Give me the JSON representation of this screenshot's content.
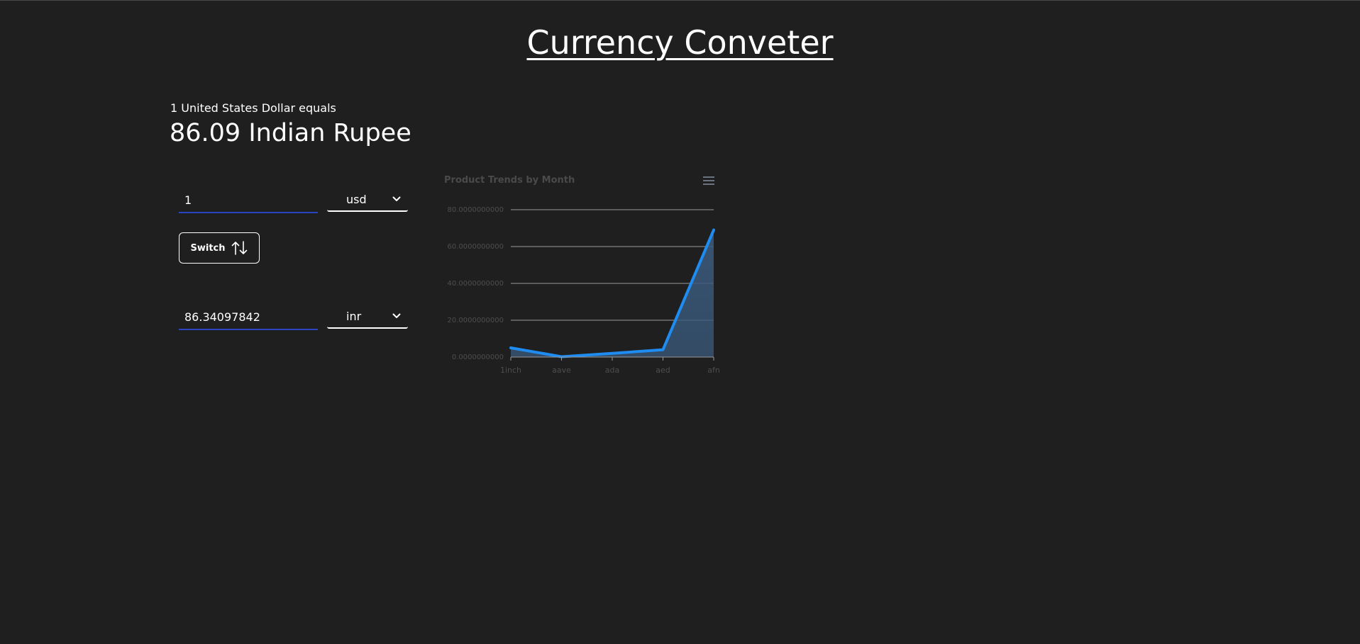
{
  "header": {
    "title": "Currency Conveter"
  },
  "rate": {
    "caption": "1 United States Dollar equals",
    "result": "86.09 Indian Rupee"
  },
  "from": {
    "amount": "1",
    "currency": "usd"
  },
  "switch": {
    "label": "Switch",
    "icon": "swap-vertical-icon"
  },
  "to": {
    "amount": "86.34097842",
    "currency": "inr"
  },
  "chart_menu": {
    "icon": "hamburger-menu-icon"
  },
  "colors": {
    "background": "#1f1f1f",
    "line": "#1e8cf0",
    "area": "#3a5a7c",
    "from_underline": "#2a44c2",
    "title_text": "#4a4a4a",
    "axis_text": "#4e4e4e",
    "grid": "#9a9a9a"
  },
  "chart_data": {
    "type": "area",
    "title": "Product Trends by Month",
    "categories": [
      "1inch",
      "aave",
      "ada",
      "aed",
      "afn"
    ],
    "series": [
      {
        "values": [
          5,
          0.2,
          2,
          4,
          69
        ]
      }
    ],
    "yticks": [
      "0.0000000000",
      "20.0000000000",
      "40.0000000000",
      "60.0000000000",
      "80.0000000000"
    ],
    "ylim": [
      0,
      80
    ],
    "grid": true,
    "legend": "none"
  }
}
